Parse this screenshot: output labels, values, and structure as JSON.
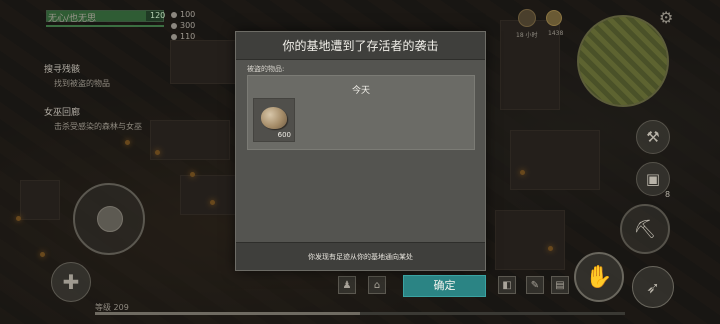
{
  "hud": {
    "player_name": "无心/也无思",
    "hp": 120,
    "hp_fraction": 0.85,
    "stats": [
      "100",
      "300",
      "110"
    ],
    "quests": [
      {
        "title": "搜寻残骸",
        "sub": "找到被盗的物品"
      },
      {
        "title": "女巫回廊",
        "sub": "击杀受感染的森林与女巫"
      }
    ],
    "top_labels": [
      "18 小时",
      "1438"
    ],
    "inventory_count": "8",
    "level_label": "等级 209",
    "xp_fraction": 0.5,
    "icons": [
      "gear-icon",
      "hammer-icon",
      "pickaxe-icon",
      "run-icon",
      "hand-icon",
      "plus-icon"
    ]
  },
  "dialog": {
    "title": "你的基地遭到了存活者的袭击",
    "stolen_label": "被盗的物品:",
    "day_label": "今天",
    "items": [
      {
        "name": "stone",
        "icon": "stone-icon",
        "count": "600"
      }
    ],
    "footer": "你发现有足迹从你的基地通向某处",
    "confirm": "确定"
  },
  "colors": {
    "dialog_bg": "#545450",
    "header_bg": "#3f3f3c",
    "confirm_bg": "#2b8484"
  }
}
